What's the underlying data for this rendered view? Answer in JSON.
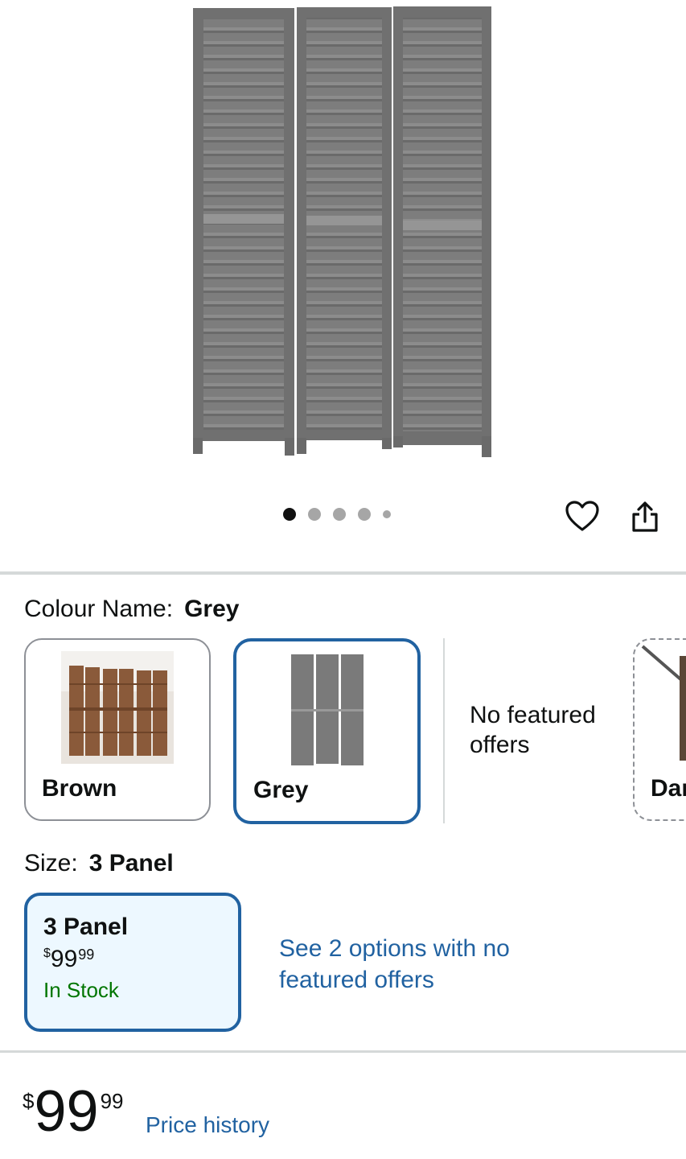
{
  "gallery": {
    "image_name": "3 panel grey folding room divider",
    "dot_count": 5,
    "active_index": 0
  },
  "actions": {
    "wishlist_icon": "heart-icon",
    "share_icon": "share-icon"
  },
  "colour": {
    "label": "Colour Name:",
    "selected": "Grey",
    "options": [
      {
        "name": "Brown",
        "selected": false
      },
      {
        "name": "Grey",
        "selected": true
      },
      {
        "name": "Dar",
        "selected": false,
        "unavailable": true
      }
    ],
    "no_featured_offers": "No featured offers"
  },
  "size": {
    "label": "Size:",
    "selected": "3 Panel",
    "card": {
      "title": "3 Panel",
      "currency": "$",
      "price_whole": "99",
      "price_cents": "99",
      "stock": "In Stock"
    },
    "see_options": "See 2 options with no featured offers"
  },
  "price": {
    "currency": "$",
    "whole": "99",
    "cents": "99",
    "history_link": "Price history"
  },
  "colors": {
    "link": "#2162a1",
    "selected_border": "#2162a1",
    "in_stock": "#007600",
    "divider": "#d5d9d9"
  }
}
